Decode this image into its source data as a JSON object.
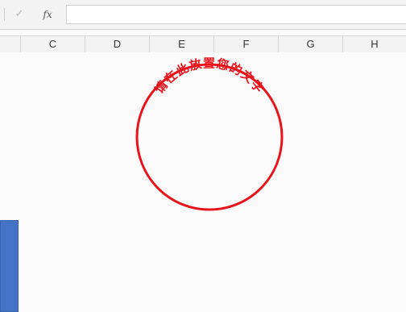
{
  "formula_bar": {
    "confirm_icon": "check-icon",
    "confirm_glyph": "✓",
    "function_icon": "fx-icon",
    "function_label": "fx",
    "value": ""
  },
  "columns": [
    "C",
    "D",
    "E",
    "F",
    "G",
    "H"
  ],
  "seal": {
    "text": "请在此放置您的文字",
    "color": "#e8141c"
  },
  "shape": {
    "color": "#4472c4"
  }
}
